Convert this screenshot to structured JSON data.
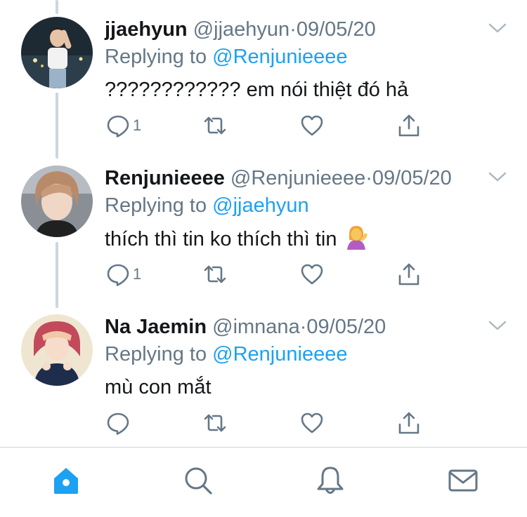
{
  "tweets": [
    {
      "name": "jjaehyun",
      "handle": "@jjaehyun",
      "separator": "·",
      "date": "09/05/20",
      "replying_prefix": "Replying to",
      "replying_to": "@Renjunieeee",
      "text": "???????????? em nói thiệt đó hả",
      "reply_count": "1"
    },
    {
      "name": "Renjunieeee",
      "handle": "@Renjunieeee",
      "separator": "·",
      "date": "09/05/20",
      "replying_prefix": "Replying to",
      "replying_to": "@jjaehyun",
      "text": "thích thì tin ko thích thì tin",
      "emoji": "person-tipping-hand-emoji",
      "reply_count": "1"
    },
    {
      "name": "Na Jaemin",
      "handle": "@imnana",
      "separator": "·",
      "date": "09/05/20",
      "replying_prefix": "Replying to",
      "replying_to": "@Renjunieeee",
      "text": "mù con mắt",
      "reply_count": ""
    }
  ],
  "colors": {
    "accent": "#1da1f2",
    "secondary_text": "#657786",
    "icon": "#657786",
    "thread_line": "#ccd6dd"
  },
  "tabbar": [
    "home-icon",
    "search-icon",
    "notifications-icon",
    "messages-icon"
  ]
}
